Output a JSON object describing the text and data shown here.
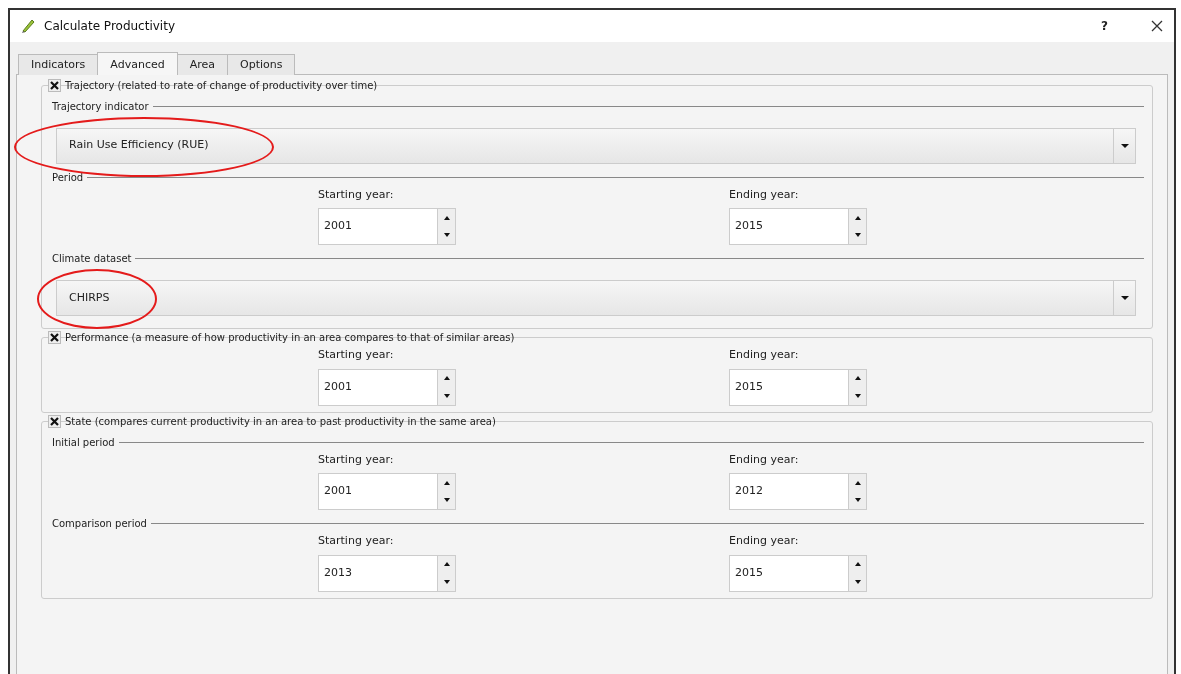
{
  "window": {
    "title": "Calculate Productivity",
    "help": "?"
  },
  "tabs": [
    {
      "label": "Indicators",
      "selected": false
    },
    {
      "label": "Advanced",
      "selected": true
    },
    {
      "label": "Area",
      "selected": false
    },
    {
      "label": "Options",
      "selected": false
    }
  ],
  "sections": [
    {
      "title": "Trajectory (related to rate of change of  productivity over time)",
      "checked": true,
      "groups": [
        {
          "kind": "combo",
          "label": "Trajectory indicator",
          "value": "Rain Use Efficiency (RUE)",
          "highlighted": true
        },
        {
          "kind": "years",
          "label": "Period",
          "start_label": "Starting year:",
          "start": "2001",
          "end_label": "Ending year:",
          "end": "2015"
        },
        {
          "kind": "combo",
          "label": "Climate dataset",
          "value": "CHIRPS",
          "highlighted": true
        }
      ]
    },
    {
      "title": "Performance (a measure of how productivity in an area compares to that of similar areas)",
      "checked": true,
      "groups": [
        {
          "kind": "years",
          "start_label": "Starting year:",
          "start": "2001",
          "end_label": "Ending year:",
          "end": "2015"
        }
      ]
    },
    {
      "title": "State (compares current productivity in an area to past productivity in the same area)",
      "checked": true,
      "groups": [
        {
          "kind": "years",
          "label": "Initial period",
          "start_label": "Starting year:",
          "start": "2001",
          "end_label": "Ending year:",
          "end": "2012"
        },
        {
          "kind": "years",
          "label": "Comparison period",
          "start_label": "Starting year:",
          "start": "2013",
          "end_label": "Ending year:",
          "end": "2015"
        }
      ]
    }
  ]
}
